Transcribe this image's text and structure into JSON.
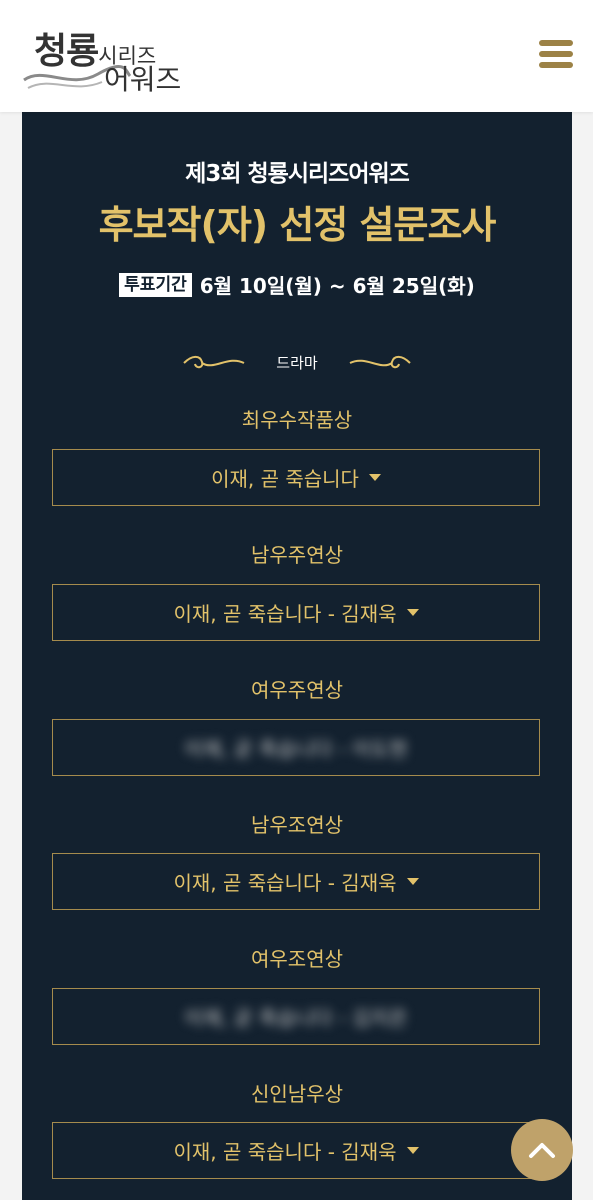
{
  "header": {
    "logo_line1": "청룡",
    "logo_line1_small": "시리즈",
    "logo_line2": "어워즈",
    "menu_icon": "hamburger-menu-icon"
  },
  "survey": {
    "subtitle": "제3회 청룡시리즈어워즈",
    "title": "후보작(자) 선정 설문조사",
    "period_badge": "투표기간",
    "period_text": "6월 10일(월) ~ 6월 25일(화)",
    "section_label": "드라마"
  },
  "categories": [
    {
      "label": "최우수작품상",
      "value": "이재, 곧 죽습니다",
      "blurred": false
    },
    {
      "label": "남우주연상",
      "value": "이재, 곧 죽습니다 - 김재욱",
      "blurred": false
    },
    {
      "label": "여우주연상",
      "value": "이재, 곧 죽습니다 - 이도현",
      "blurred": true
    },
    {
      "label": "남우조연상",
      "value": "이재, 곧 죽습니다 - 김재욱",
      "blurred": false
    },
    {
      "label": "여우조연상",
      "value": "이재, 곧 죽습니다 - 김지은",
      "blurred": true
    },
    {
      "label": "신인남우상",
      "value": "이재, 곧 죽습니다 - 김재욱",
      "blurred": false
    }
  ],
  "colors": {
    "gold": "#e2c26a",
    "navy": "#13212f",
    "menu": "#9c8246",
    "scroll_top": "#bfa26a"
  },
  "scroll_top_icon": "chevron-up-icon"
}
